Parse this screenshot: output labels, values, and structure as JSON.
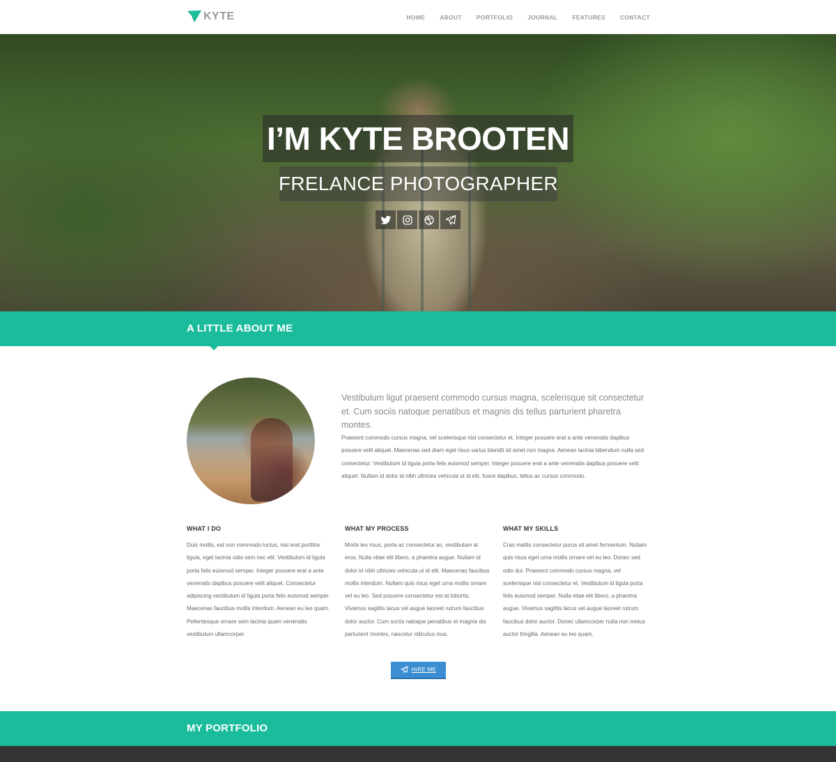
{
  "brand": {
    "logo_text": "KYTE",
    "accent_color": "#1abc9c",
    "button_color": "#3b8ed1"
  },
  "nav": {
    "items": [
      "HOME",
      "ABOUT",
      "PORTFOLIO",
      "JOURNAL",
      "FEATURES",
      "CONTACT"
    ]
  },
  "hero": {
    "title": "I’M KYTE BROOTEN",
    "subtitle": "FRELANCE PHOTOGRAPHER",
    "socials": [
      "twitter-icon",
      "instagram-icon",
      "dribbble-icon",
      "paper-plane-icon"
    ]
  },
  "about": {
    "section_title": "A LITTLE ABOUT ME",
    "lead": "Vestibulum ligut praesent commodo cursus magna, scelerisque sit consectetur et. Cum sociis natoque penatibus et magnis dis tellus parturient pharetra montes.",
    "body": "Praesent commodo cursus magna, vel scelerisque nisl consectetur et. Integer posuere erat a ante venenatis dapibus posuere velit aliquet. Maecenas sed diam eget risus varius blandit sit amet non magna. Aenean lacinia bibendum nulla sed consectetur. Vestibulum id ligula porta felis euismod semper. Integer posuere erat a ante venenatis dapibus posuere velit aliquet. Nullam id dolor id nibh ultricies vehicula ut id elit, fusce dapibus, tellus ac cursus commodo.",
    "columns": [
      {
        "title": "WHAT I DO",
        "text": "Duis mollis, est non commodo luctus, nisi erat porttitor ligula, eget lacinia odio sem nec elit. Vestibulum id ligula porta felis euismod semper. Integer posuere erat a ante venenatis dapibus posuere velit aliquet. Consectetur adipiscing vestibulum id ligula porta felis euismod semper. Maecenas faucibus mollis interdum. Aenean eu leo quam. Pellentesque ornare sem lacinia quam venenatis vestibulum ullamcorper."
      },
      {
        "title": "WHAT MY PROCESS",
        "text": "Morbi leo risus, porta ac consectetur ac, vestibulum at eros. Nulla vitae elit libero, a pharetra augue. Nullam id dolor id nibh ultricies vehicula ut id elit. Maecenas faucibus mollis interdum. Nullam quis risus eget urna mollis ornare vel eu leo. Sed posuere consectetur est at lobortis. Vivamus sagittis lacus vel augue laoreet rutrum faucibus dolor auctor. Cum sociis natoque penatibus et magnis dis parturient montes, nascetur ridiculus mus."
      },
      {
        "title": "WHAT MY SKILLS",
        "text": "Cras mattis consectetur purus sit amet fermentum. Nullam quis risus eget urna mollis ornare vel eu leo. Donec sed odio dui. Praesent commodo cursus magna, vel scelerisque nisl consectetur et. Vestibulum id ligula porta felis euismod semper. Nulla vitae elit libero, a pharetra augue. Vivamus sagittis lacus vel augue laoreet rutrum faucibus dolor auctor. Donec ullamcorper nulla non metus auctor fringilla. Aenean eu leo quam."
      }
    ],
    "hire_label": "HIRE ME"
  },
  "portfolio": {
    "section_title": "MY PORTFOLIO"
  }
}
